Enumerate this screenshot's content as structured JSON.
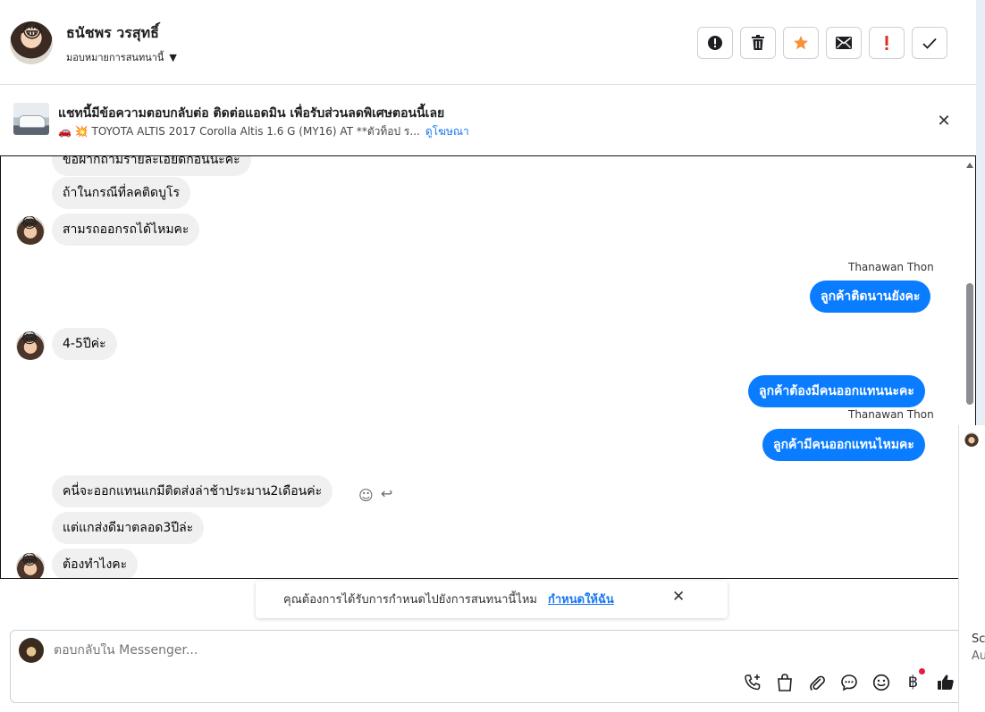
{
  "header": {
    "name": "ธนัชพร วรสุทธิ์",
    "assign_label": "มอบหมายการสนทนานี้",
    "tools": [
      {
        "name": "spam-button",
        "icon": "alert-circle-icon"
      },
      {
        "name": "delete-button",
        "icon": "trash-icon"
      },
      {
        "name": "star-button",
        "icon": "star-icon"
      },
      {
        "name": "mark-unread-button",
        "icon": "envelope-icon"
      },
      {
        "name": "important-button",
        "icon": "exclamation-icon"
      },
      {
        "name": "done-button",
        "icon": "check-icon"
      }
    ],
    "accent_star": "#f7923a",
    "accent_important": "#d93025"
  },
  "ad": {
    "title": "แชทนี้มีข้อความตอบกลับต่อ ติดต่อแอดมิน เพื่อรับส่วนลดพิเศษตอนนี้เลย",
    "subtitle": "🚗 💥 TOYOTA ALTIS 2017 Corolla Altis 1.6 G (MY16) AT **ตัวท็อป ร...",
    "link": "ดูโฆษณา"
  },
  "messages": {
    "cut_top": "ขอฝากถามรายละเอียดก่อนนะคะ",
    "m1": "ถ้าในกรณีที่ลคติดบูโร",
    "m2": "สามรถออกรถได้ไหมคะ",
    "sender1": "Thanawan Thon",
    "o1": "ลูกค้าติดนานยังคะ",
    "m3": "4-5ปีค่ะ",
    "o2": "ลูกค้าต้องมีคนออกแทนนะคะ",
    "sender2": "Thanawan Thon",
    "o3": "ลูกค้ามีคนออกแทนไหมคะ",
    "m4": "คนี่จะออกแทนแกมีติดส่งล่าช้าประมาน2เดือนค่ะ",
    "m5": "แต่แกส่งดีมาตลอด3ปีล่ะ",
    "m6": "ต้องทำไงคะ",
    "outgoing_color": "#0a7cff",
    "incoming_color": "#f0f0f0"
  },
  "followup": {
    "text": "คุณต้องการได้รับการกำหนดไปยังการสนทนานี้ไหม",
    "link": "กำหนดให้ฉัน"
  },
  "composer": {
    "placeholder": "ตอบกลับใน Messenger...",
    "icons": [
      "call-add-icon",
      "shopping-bag-icon",
      "paperclip-icon",
      "saved-reply-icon",
      "emoji-icon",
      "baht-payment-icon",
      "thumbs-up-icon"
    ]
  },
  "peek": {
    "text1": "Sc",
    "text2": "Au"
  }
}
